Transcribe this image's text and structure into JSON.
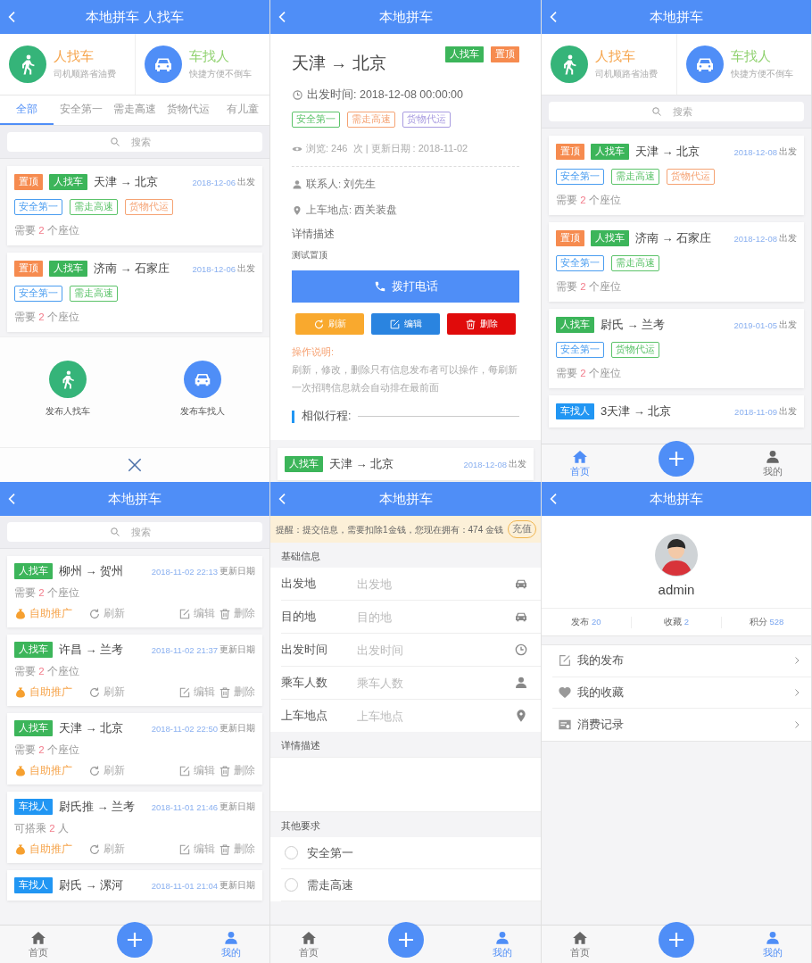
{
  "screens": [
    {
      "kind": "list_popup",
      "title": "本地拼车 人找车",
      "categories": [
        {
          "title": "人找车",
          "subtitle": "司机顺路省油费"
        },
        {
          "title": "车找人",
          "subtitle": "快捷方便不倒车"
        }
      ],
      "tabs": [
        {
          "label": "全部",
          "selected": true
        },
        {
          "label": "安全第一",
          "selected": false
        },
        {
          "label": "需走高速",
          "selected": false
        },
        {
          "label": "货物代运",
          "selected": false
        },
        {
          "label": "有儿童",
          "selected": false
        }
      ],
      "search": {
        "placeholder": "搜索"
      },
      "cards": [
        {
          "badges": [
            {
              "text": "置顶",
              "color": "#f68b4f"
            },
            {
              "text": "人找车",
              "color": "#3cb55a"
            }
          ],
          "route": "天津 → 北京",
          "date": "2018-12-06",
          "date_suffix": "出发",
          "tags": [
            {
              "text": "安全第一",
              "color": "#4a9df0"
            },
            {
              "text": "需走高速",
              "color": "#5cc36a"
            },
            {
              "text": "货物代运",
              "color": "#f5a374"
            }
          ],
          "seats": {
            "before": "需要",
            "count": "2",
            "after": "个座位"
          }
        },
        {
          "badges": [
            {
              "text": "置顶",
              "color": "#f68b4f"
            },
            {
              "text": "人找车",
              "color": "#3cb55a"
            }
          ],
          "route": "济南 → 石家庄",
          "date": "2018-12-06",
          "date_suffix": "出发",
          "tags": [
            {
              "text": "安全第一",
              "color": "#4a9df0"
            },
            {
              "text": "需走高速",
              "color": "#5cc36a"
            }
          ],
          "seats": {
            "before": "需要",
            "count": "2",
            "after": "个座位"
          }
        }
      ],
      "popup": {
        "actions": [
          {
            "label": "发布人找车"
          },
          {
            "label": "发布车找人"
          }
        ]
      }
    },
    {
      "kind": "detail",
      "title": "本地拼车",
      "route": "天津 → 北京",
      "badges": [
        {
          "text": "人找车",
          "color": "#3cb55a"
        },
        {
          "text": "置顶",
          "color": "#f68b4f"
        }
      ],
      "departure": "出发时间: 2018-12-08 00:00:00",
      "tags": [
        {
          "text": "安全第一",
          "color": "#5cc36a"
        },
        {
          "text": "需走高速",
          "color": "#f5a374"
        },
        {
          "text": "货物代运",
          "color": "#a89be0"
        }
      ],
      "views": "浏览: 246  次 | 更新日期 : 2018-11-02",
      "contact": "联系人: 刘先生",
      "pickup": "上车地点: 西关装盘",
      "description_label": "详情描述",
      "description": "测试置顶",
      "call_button": "拨打电话",
      "actions": [
        {
          "label": "刷新",
          "kind": "refresh",
          "color": "#f9a92e"
        },
        {
          "label": "编辑",
          "kind": "edit",
          "color": "#2a84e0"
        },
        {
          "label": "删除",
          "kind": "delete",
          "color": "#e00b0b"
        }
      ],
      "note_title": "操作说明:",
      "note": "刷新，修改，删除只有信息发布者可以操作，每刷新一次招聘信息就会自动排在最前面",
      "similar_title": "相似行程:",
      "similar": [
        {
          "badges": [
            {
              "text": "人找车",
              "color": "#3cb55a"
            }
          ],
          "route": "天津 → 北京",
          "date": "2018-12-08",
          "date_suffix": "出发"
        }
      ]
    },
    {
      "kind": "list",
      "title": "本地拼车",
      "categories": [
        {
          "title": "人找车",
          "subtitle": "司机顺路省油费"
        },
        {
          "title": "车找人",
          "subtitle": "快捷方便不倒车"
        }
      ],
      "search": {
        "placeholder": "搜索"
      },
      "cards": [
        {
          "badges": [
            {
              "text": "置顶",
              "color": "#f68b4f"
            },
            {
              "text": "人找车",
              "color": "#3cb55a"
            }
          ],
          "route": "天津 → 北京",
          "date": "2018-12-08",
          "date_suffix": "出发",
          "tags": [
            {
              "text": "安全第一",
              "color": "#4a9df0"
            },
            {
              "text": "需走高速",
              "color": "#5cc36a"
            },
            {
              "text": "货物代运",
              "color": "#f5a374"
            }
          ],
          "seats": {
            "before": "需要",
            "count": "2",
            "after": "个座位"
          }
        },
        {
          "badges": [
            {
              "text": "置顶",
              "color": "#f68b4f"
            },
            {
              "text": "人找车",
              "color": "#3cb55a"
            }
          ],
          "route": "济南 → 石家庄",
          "date": "2018-12-08",
          "date_suffix": "出发",
          "tags": [
            {
              "text": "安全第一",
              "color": "#4a9df0"
            },
            {
              "text": "需走高速",
              "color": "#5cc36a"
            }
          ],
          "seats": {
            "before": "需要",
            "count": "2",
            "after": "个座位"
          }
        },
        {
          "badges": [
            {
              "text": "人找车",
              "color": "#3cb55a"
            }
          ],
          "route": "尉氏 → 兰考",
          "date": "2019-01-05",
          "date_suffix": "出发",
          "tags": [
            {
              "text": "安全第一",
              "color": "#4a9df0"
            },
            {
              "text": "货物代运",
              "color": "#5cc36a"
            }
          ],
          "seats": {
            "before": "需要",
            "count": "2",
            "after": "个座位"
          }
        },
        {
          "badges": [
            {
              "text": "车找人",
              "color": "#2196f3"
            }
          ],
          "route": "3天津 → 北京",
          "date": "2018-11-09",
          "date_suffix": "出发"
        }
      ],
      "nav": {
        "items": [
          {
            "label": "首页",
            "selected": true
          },
          {
            "label": "我的",
            "selected": false
          }
        ]
      }
    },
    {
      "kind": "my_posts",
      "title": "本地拼车",
      "search": {
        "placeholder": "搜索"
      },
      "cards": [
        {
          "badges": [
            {
              "text": "人找车",
              "color": "#3cb55a"
            }
          ],
          "route": "柳州 → 贺州",
          "date": "2018-11-02 22:13",
          "date_suffix": "更新日期",
          "seats": {
            "before": "需要",
            "count": "2",
            "after": "个座位"
          },
          "actions": [
            {
              "label": "自助推广",
              "kind": "promote"
            },
            {
              "label": "刷新",
              "kind": "refresh"
            },
            {
              "label": "编辑",
              "kind": "edit"
            },
            {
              "label": "删除",
              "kind": "delete"
            }
          ]
        },
        {
          "badges": [
            {
              "text": "人找车",
              "color": "#3cb55a"
            }
          ],
          "route": "许昌 → 兰考",
          "date": "2018-11-02 21:37",
          "date_suffix": "更新日期",
          "seats": {
            "before": "需要",
            "count": "2",
            "after": "个座位"
          },
          "actions": [
            {
              "label": "自助推广",
              "kind": "promote"
            },
            {
              "label": "刷新",
              "kind": "refresh"
            },
            {
              "label": "编辑",
              "kind": "edit"
            },
            {
              "label": "删除",
              "kind": "delete"
            }
          ]
        },
        {
          "badges": [
            {
              "text": "人找车",
              "color": "#3cb55a"
            }
          ],
          "route": "天津 → 北京",
          "date": "2018-11-02 22:50",
          "date_suffix": "更新日期",
          "seats": {
            "before": "需要",
            "count": "2",
            "after": "个座位"
          },
          "actions": [
            {
              "label": "自助推广",
              "kind": "promote"
            },
            {
              "label": "刷新",
              "kind": "refresh"
            },
            {
              "label": "编辑",
              "kind": "edit"
            },
            {
              "label": "删除",
              "kind": "delete"
            }
          ]
        },
        {
          "badges": [
            {
              "text": "车找人",
              "color": "#2196f3"
            }
          ],
          "route": "尉氏推 → 兰考",
          "date": "2018-11-01 21:46",
          "date_suffix": "更新日期",
          "seats": {
            "before": "可搭乘",
            "count": "2",
            "after": "人"
          },
          "actions": [
            {
              "label": "自助推广",
              "kind": "promote"
            },
            {
              "label": "刷新",
              "kind": "refresh"
            },
            {
              "label": "编辑",
              "kind": "edit"
            },
            {
              "label": "删除",
              "kind": "delete"
            }
          ]
        },
        {
          "badges": [
            {
              "text": "车找人",
              "color": "#2196f3"
            }
          ],
          "route": "尉氏 → 漯河",
          "date": "2018-11-01 21:04",
          "date_suffix": "更新日期"
        }
      ],
      "nav": {
        "items": [
          {
            "label": "首页",
            "selected": false
          },
          {
            "label": "我的",
            "selected": true
          }
        ]
      }
    },
    {
      "kind": "form",
      "title": "本地拼车",
      "notice": "提醒：提交信息，需要扣除1金钱，您现在拥有：474 金钱",
      "recharge_button": "充值",
      "basic_title": "基础信息",
      "fields": [
        {
          "label": "出发地",
          "placeholder": "出发地"
        },
        {
          "label": "目的地",
          "placeholder": "目的地"
        },
        {
          "label": "出发时间",
          "placeholder": "出发时间"
        },
        {
          "label": "乘车人数",
          "placeholder": "乘车人数"
        },
        {
          "label": "上车地点",
          "placeholder": "上车地点"
        }
      ],
      "description_title": "详情描述",
      "other_title": "其他要求",
      "options": [
        {
          "label": "安全第一",
          "checked": false
        },
        {
          "label": "需走高速",
          "checked": false
        }
      ],
      "nav": {
        "items": [
          {
            "label": "首页",
            "selected": false
          },
          {
            "label": "我的",
            "selected": true
          }
        ]
      }
    },
    {
      "kind": "profile",
      "title": "本地拼车",
      "username": "admin",
      "stats": [
        {
          "label": "发布",
          "value": "20"
        },
        {
          "label": "收藏",
          "value": "2"
        },
        {
          "label": "积分",
          "value": "528"
        }
      ],
      "menu": [
        {
          "label": "我的发布"
        },
        {
          "label": "我的收藏"
        },
        {
          "label": "消费记录"
        }
      ],
      "nav": {
        "items": [
          {
            "label": "首页",
            "selected": false
          },
          {
            "label": "我的",
            "selected": true
          }
        ]
      }
    }
  ]
}
